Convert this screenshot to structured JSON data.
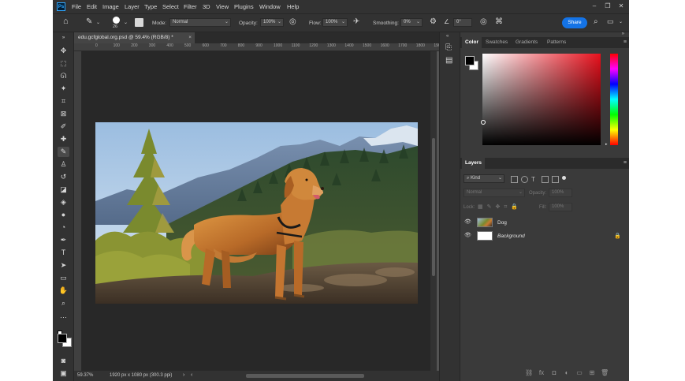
{
  "menu": {
    "logo": "Ps",
    "items": [
      "File",
      "Edit",
      "Image",
      "Layer",
      "Type",
      "Select",
      "Filter",
      "3D",
      "View",
      "Plugins",
      "Window",
      "Help"
    ]
  },
  "options": {
    "brush_size": "26",
    "mode_label": "Mode:",
    "mode_value": "Normal",
    "opacity_label": "Opacity:",
    "opacity_value": "100%",
    "flow_label": "Flow:",
    "flow_value": "100%",
    "smoothing_label": "Smoothing:",
    "smoothing_value": "0%",
    "angle_value": "0°",
    "share_label": "Share"
  },
  "document": {
    "tab_title": "edu.gcfglobal.org.psd @ 59.4% (RGB/8) *",
    "tab_close": "×",
    "ruler_ticks": [
      "0",
      "100",
      "200",
      "300",
      "400",
      "500",
      "600",
      "700",
      "800",
      "900",
      "1000",
      "1100",
      "1200",
      "1300",
      "1400",
      "1500",
      "1600",
      "1700",
      "1800",
      "1900"
    ],
    "zoom": "59.37%",
    "doc_info": "1920 px x 1080 px (300.3 ppi)"
  },
  "panels": {
    "color_tabs": [
      "Color",
      "Swatches",
      "Gradients",
      "Patterns"
    ],
    "layers_tab": "Layers",
    "kind_label": "Kind",
    "blend_mode": "Normal",
    "opacity_label": "Opacity:",
    "opacity_value": "100%",
    "lock_label": "Lock:",
    "fill_label": "Fill:",
    "fill_value": "100%",
    "layers": [
      {
        "name": "Dog",
        "italic": false
      },
      {
        "name": "Background",
        "italic": true
      }
    ]
  },
  "colors": {
    "accent": "#1473e6",
    "panel_bg": "#3a3a3a",
    "canvas_bg": "#282828"
  }
}
